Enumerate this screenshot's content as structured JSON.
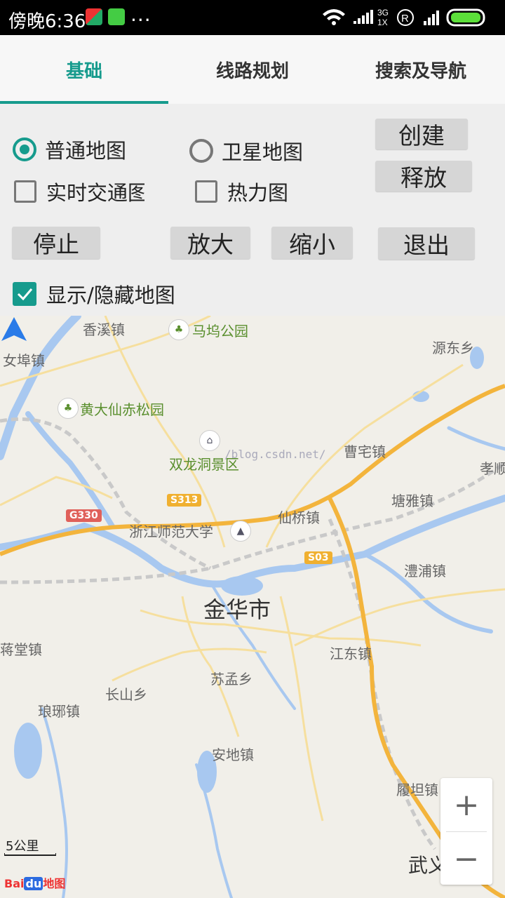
{
  "status_bar": {
    "time": "傍晚6:36",
    "more": "...",
    "network_top": "3G",
    "network_bottom": "1X",
    "roaming": "R"
  },
  "tabs": [
    {
      "label": "基础",
      "active": true
    },
    {
      "label": "线路规划",
      "active": false
    },
    {
      "label": "搜索及导航",
      "active": false
    }
  ],
  "controls": {
    "radio_normal": "普通地图",
    "radio_satellite": "卫星地图",
    "check_traffic": "实时交通图",
    "check_heat": "热力图",
    "check_showmap": "显示/隐藏地图",
    "btn_create": "创建",
    "btn_release": "释放",
    "btn_stop": "停止",
    "btn_zoomin": "放大",
    "btn_zoomout": "缩小",
    "btn_exit": "退出"
  },
  "map": {
    "labels": {
      "xiangxi": "香溪镇",
      "mawu": "马坞公园",
      "yuandong": "源东乡",
      "nubu": "女埠镇",
      "huangdaxian": "黄大仙赤松园",
      "shuanglong": "双龙洞景区",
      "caozhai": "曹宅镇",
      "xiaoshun": "孝顺",
      "tangya": "塘雅镇",
      "xianqiao": "仙桥镇",
      "zjnu": "浙江师范大学",
      "lipu": "澧浦镇",
      "jinhua": "金华市",
      "luotang": "蒋堂镇",
      "jiangdong": "江东镇",
      "sumeng": "苏孟乡",
      "changshan": "长山乡",
      "langya": "琅琊镇",
      "andi": "安地镇",
      "lutan": "履坦镇",
      "wuyi": "武义县"
    },
    "shields": {
      "s313": "S313",
      "g330": "G330",
      "s03": "S03"
    },
    "watermark": "/blog.csdn.net/",
    "scale": "5公里",
    "logo_bai": "Bai",
    "logo_du": "du",
    "logo_map": "地图",
    "zoom_in": "+",
    "zoom_out": "−"
  }
}
